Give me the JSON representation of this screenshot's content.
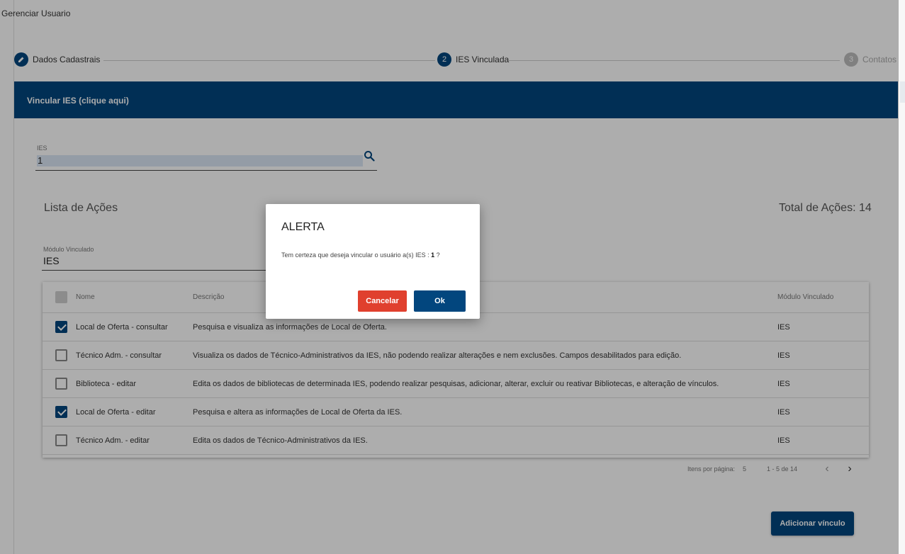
{
  "page": {
    "title": "Gerenciar Usuario"
  },
  "stepper": {
    "steps": [
      {
        "number": "",
        "label": "Dados Cadastrais",
        "state": "done"
      },
      {
        "number": "2",
        "label": "IES Vinculada",
        "state": "active"
      },
      {
        "number": "3",
        "label": "Contatos",
        "state": "inactive"
      }
    ]
  },
  "vincular": {
    "header": "Vincular IES (clique aqui)"
  },
  "ies_field": {
    "label": "IES",
    "value": "1"
  },
  "lista": {
    "title": "Lista de Ações",
    "total_label": "Total de Ações:  14"
  },
  "modulo_field": {
    "label": "Módulo Vinculado",
    "value": "IES"
  },
  "table": {
    "headers": {
      "nome": "Nome",
      "descricao": "Descrição",
      "modulo": "Módulo Vinculado"
    },
    "rows": [
      {
        "checked": true,
        "nome": "Local de Oferta - consultar",
        "descricao": "Pesquisa e visualiza as informações de Local de Oferta.",
        "modulo": "IES"
      },
      {
        "checked": false,
        "nome": "Técnico Adm. - consultar",
        "descricao": "Visualiza os dados de Técnico-Administrativos da IES, não podendo realizar alterações e nem exclusões. Campos desabilitados para edição.",
        "modulo": "IES"
      },
      {
        "checked": false,
        "nome": "Biblioteca - editar",
        "descricao": "Edita os dados de bibliotecas de determinada IES, podendo realizar pesquisas, adicionar, alterar, excluir ou reativar Bibliotecas, e alteração de vínculos.",
        "modulo": "IES"
      },
      {
        "checked": true,
        "nome": "Local de Oferta - editar",
        "descricao": "Pesquisa e altera as informações de Local de Oferta da IES.",
        "modulo": "IES"
      },
      {
        "checked": false,
        "nome": "Técnico Adm. - editar",
        "descricao": "Edita os dados de Técnico-Administrativos da IES.",
        "modulo": "IES"
      }
    ]
  },
  "pager": {
    "items_per_page_label": "Itens por página:",
    "items_per_page": "5",
    "range": "1 - 5 de 14"
  },
  "buttons": {
    "add": "Adicionar vínculo"
  },
  "dialog": {
    "title": "ALERTA",
    "message_prefix": "Tem certeza que deseja vincular o usuário a(s) IES : ",
    "message_value": "1",
    "message_suffix": "  ?",
    "cancel": "Cancelar",
    "ok": "Ok"
  },
  "colors": {
    "primary": "#02467e",
    "danger": "#e0402e"
  }
}
